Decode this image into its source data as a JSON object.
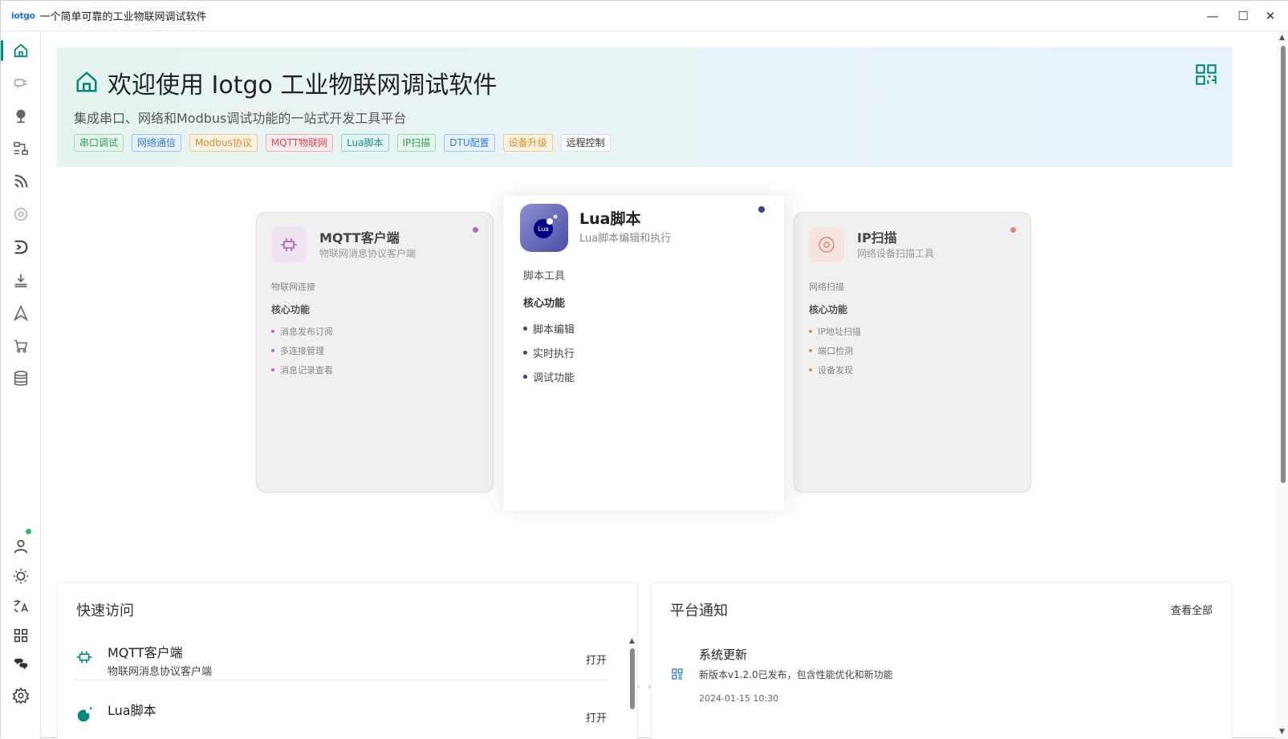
{
  "window": {
    "logo": "iotgo",
    "title": "一个简单可靠的工业物联网调试软件",
    "controls": {
      "minimize": "—",
      "maximize": "☐",
      "close": "✕"
    }
  },
  "sidebar": {
    "items": [
      {
        "name": "home",
        "icon": "home-icon",
        "active": true
      },
      {
        "name": "serial",
        "icon": "serial-plug-icon"
      },
      {
        "name": "network",
        "icon": "network-globe-icon"
      },
      {
        "name": "modbus",
        "icon": "modbus-flow-icon"
      },
      {
        "name": "mqtt",
        "icon": "rss-icon"
      },
      {
        "name": "ip-scan",
        "icon": "target-icon"
      },
      {
        "name": "dtu",
        "icon": "dtu-icon"
      },
      {
        "name": "upgrade",
        "icon": "download-icon"
      },
      {
        "name": "navigate",
        "icon": "navigation-icon"
      },
      {
        "name": "shop",
        "icon": "cart-icon"
      },
      {
        "name": "database",
        "icon": "database-icon"
      }
    ],
    "bottom_items": [
      {
        "name": "user",
        "icon": "user-icon"
      },
      {
        "name": "theme",
        "icon": "sun-icon"
      },
      {
        "name": "language",
        "icon": "translate-icon"
      },
      {
        "name": "apps",
        "icon": "apps-grid-icon"
      },
      {
        "name": "chat",
        "icon": "chat-icon"
      },
      {
        "name": "settings",
        "icon": "gear-icon"
      }
    ]
  },
  "hero": {
    "title": "欢迎使用 Iotgo 工业物联网调试软件",
    "subtitle": "集成串口、网络和Modbus调试功能的一站式开发工具平台",
    "tags": [
      {
        "label": "串口调试",
        "color": "#2e9e5b",
        "bg": "#e6f6ec",
        "border": "#9fd9b3"
      },
      {
        "label": "网络通信",
        "color": "#2f7fd6",
        "bg": "#e7f1fc",
        "border": "#9cc4ef"
      },
      {
        "label": "Modbus协议",
        "color": "#d9902a",
        "bg": "#fdf2e2",
        "border": "#f0c98c"
      },
      {
        "label": "MQTT物联网",
        "color": "#d04a5a",
        "bg": "#fdeaec",
        "border": "#f0a9b2"
      },
      {
        "label": "Lua脚本",
        "color": "#1b8f8a",
        "bg": "#e2f5f4",
        "border": "#93d3cf"
      },
      {
        "label": "IP扫描",
        "color": "#2e9e5b",
        "bg": "#e6f6ec",
        "border": "#9fd9b3"
      },
      {
        "label": "DTU配置",
        "color": "#2f7fd6",
        "bg": "#e7f1fc",
        "border": "#9cc4ef"
      },
      {
        "label": "设备升级",
        "color": "#d9902a",
        "bg": "#fdf2e2",
        "border": "#f0c98c"
      },
      {
        "label": "远程控制",
        "color": "#333333",
        "bg": "#ffffff",
        "border": "#dddddd"
      }
    ]
  },
  "carousel": {
    "cards": [
      {
        "name": "MQTT客户端",
        "desc": "物联网消息协议客户端",
        "category": "物联网连接",
        "features_title": "核心功能",
        "features": [
          "消息发布订阅",
          "多连接管理",
          "消息记录查看"
        ],
        "accent": "#b36bc6",
        "icon": "mqtt-chip-icon"
      },
      {
        "name": "Lua脚本",
        "desc": "Lua脚本编辑和执行",
        "category": "脚本工具",
        "features_title": "核心功能",
        "features": [
          "脚本编辑",
          "实时执行",
          "调试功能"
        ],
        "accent": "#3b3f8f",
        "icon": "lua-logo-icon",
        "icon_text": "Lua"
      },
      {
        "name": "IP扫描",
        "desc": "网络设备扫描工具",
        "category": "网络扫描",
        "features_title": "核心功能",
        "features": [
          "IP地址扫描",
          "端口检测",
          "设备发现"
        ],
        "accent": "#e8836a",
        "icon": "scan-target-icon"
      }
    ],
    "slide_count": 7,
    "active_slide": 1
  },
  "quick_access": {
    "title": "快速访问",
    "items": [
      {
        "name": "MQTT客户端",
        "desc": "物联网消息协议客户端",
        "action": "打开",
        "icon": "mqtt-chip-icon"
      },
      {
        "name": "Lua脚本",
        "desc": "",
        "action": "打开",
        "icon": "lua-logo-icon"
      }
    ]
  },
  "notices": {
    "title": "平台通知",
    "view_all": "查看全部",
    "items": [
      {
        "title": "系统更新",
        "body": "新版本v1.2.0已发布，包含性能优化和新功能",
        "time": "2024-01-15 10:30",
        "icon": "apps-grid-icon"
      }
    ]
  },
  "colors": {
    "accent": "#00897b",
    "online": "#2bb673"
  }
}
